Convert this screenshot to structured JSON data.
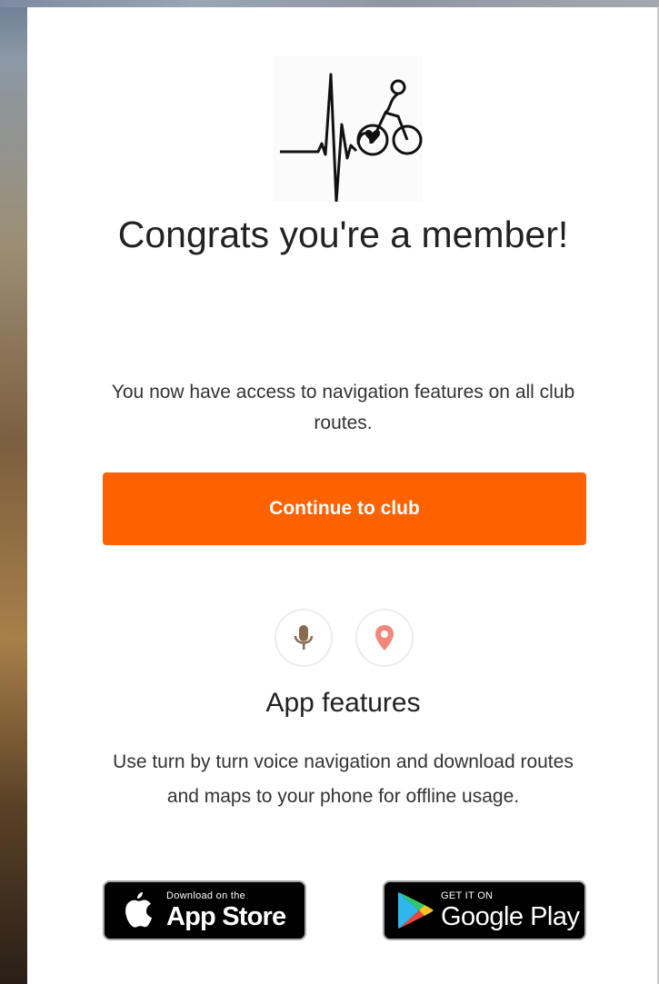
{
  "modal": {
    "title": "Congrats you're a member!",
    "description": "You now have access to navigation features on all club routes.",
    "continue_label": "Continue to club"
  },
  "features": {
    "icons": [
      "microphone-icon",
      "location-pin-icon"
    ],
    "title": "App features",
    "description": "Use turn by turn voice navigation and download routes and maps to your phone for offline usage."
  },
  "stores": {
    "apple_small": "Download on the",
    "apple_big": "App Store",
    "google_small": "GET IT ON",
    "google_big": "Google Play"
  },
  "colors": {
    "accent": "#fc6200",
    "mic": "#8c6a4f",
    "pin": "#f2887a"
  }
}
